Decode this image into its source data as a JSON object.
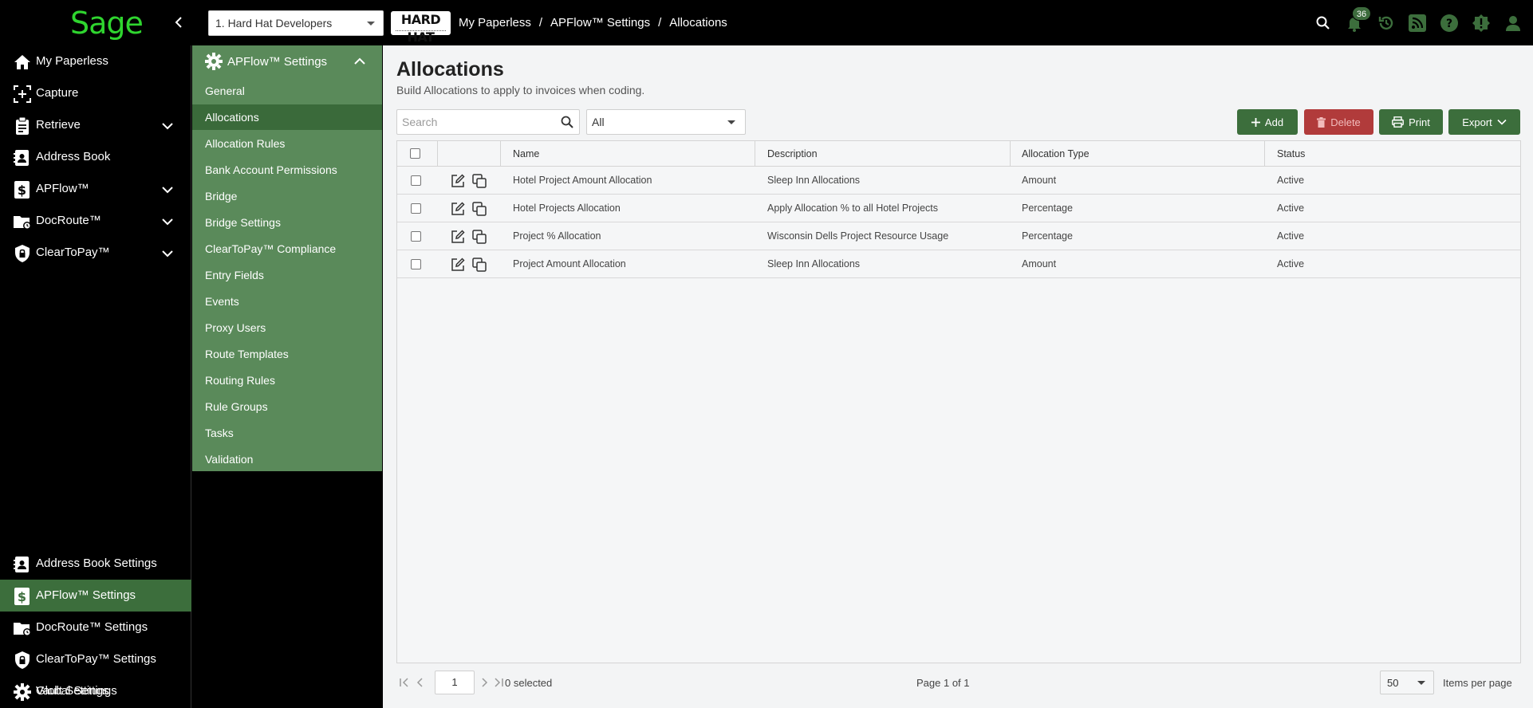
{
  "header": {
    "logo": "Sage",
    "company": "1. Hard Hat Developers",
    "brand": "HARD HAT",
    "breadcrumb": [
      "My Paperless",
      "APFlow™ Settings",
      "Allocations"
    ],
    "notification_count": "36",
    "icons": [
      "search-icon",
      "bell-icon",
      "history-icon",
      "rss-icon",
      "help-icon",
      "alert-icon",
      "user-icon"
    ]
  },
  "sidebar": {
    "top_items": [
      {
        "label": "My Paperless",
        "icon": "home-icon"
      },
      {
        "label": "Capture",
        "icon": "capture-icon"
      },
      {
        "label": "Retrieve",
        "icon": "clipboard-icon"
      },
      {
        "label": "Address Book",
        "icon": "address-book-icon"
      },
      {
        "label": "APFlow™",
        "icon": "dollar-icon"
      },
      {
        "label": "DocRoute™",
        "icon": "folder-icon"
      },
      {
        "label": "ClearToPay™",
        "icon": "shield-lock-icon"
      }
    ],
    "bottom_items": [
      {
        "label": "Address Book Settings",
        "icon": "address-book-icon"
      },
      {
        "label": "APFlow™ Settings",
        "icon": "dollar-icon"
      },
      {
        "label": "DocRoute™ Settings",
        "icon": "folder-icon"
      },
      {
        "label": "ClearToPay™ Settings",
        "icon": "shield-lock-icon"
      },
      {
        "label": "Vault Settings",
        "icon": "gear-icon"
      },
      {
        "label": "Global Settings",
        "icon": "gear-icon"
      }
    ]
  },
  "subnav": {
    "title": "APFlow™ Settings",
    "items": [
      "General",
      "Allocations",
      "Allocation Rules",
      "Bank Account Permissions",
      "Bridge",
      "Bridge Settings",
      "ClearToPay™ Compliance",
      "Entry Fields",
      "Events",
      "Proxy Users",
      "Route Templates",
      "Routing Rules",
      "Rule Groups",
      "Tasks",
      "Validation"
    ],
    "active": "Allocations"
  },
  "main": {
    "title": "Allocations",
    "subtitle": "Build Allocations to apply to invoices when coding.",
    "search_placeholder": "Search",
    "filter_value": "All",
    "buttons": {
      "add": "Add",
      "delete": "Delete",
      "print": "Print",
      "export": "Export"
    },
    "columns": [
      "Name",
      "Description",
      "Allocation Type",
      "Status"
    ],
    "rows": [
      {
        "name": "Hotel Project Amount Allocation",
        "description": "Sleep Inn Allocations",
        "type": "Amount",
        "status": "Active"
      },
      {
        "name": "Hotel Projects Allocation",
        "description": "Apply Allocation % to all Hotel Projects",
        "type": "Percentage",
        "status": "Active"
      },
      {
        "name": "Project % Allocation",
        "description": "Wisconsin Dells Project Resource Usage",
        "type": "Percentage",
        "status": "Active"
      },
      {
        "name": "Project Amount Allocation",
        "description": "Sleep Inn Allocations",
        "type": "Amount",
        "status": "Active"
      }
    ],
    "pager": {
      "page_input": "1",
      "selected": "0 selected",
      "page_of": "Page 1 of 1",
      "per_page": "50",
      "per_page_label": "Items per page"
    }
  },
  "colors": {
    "accent": "#3c6e3c",
    "subnav": "#5a8a5a",
    "danger": "#b13b3b",
    "logo": "#2fd52f"
  }
}
